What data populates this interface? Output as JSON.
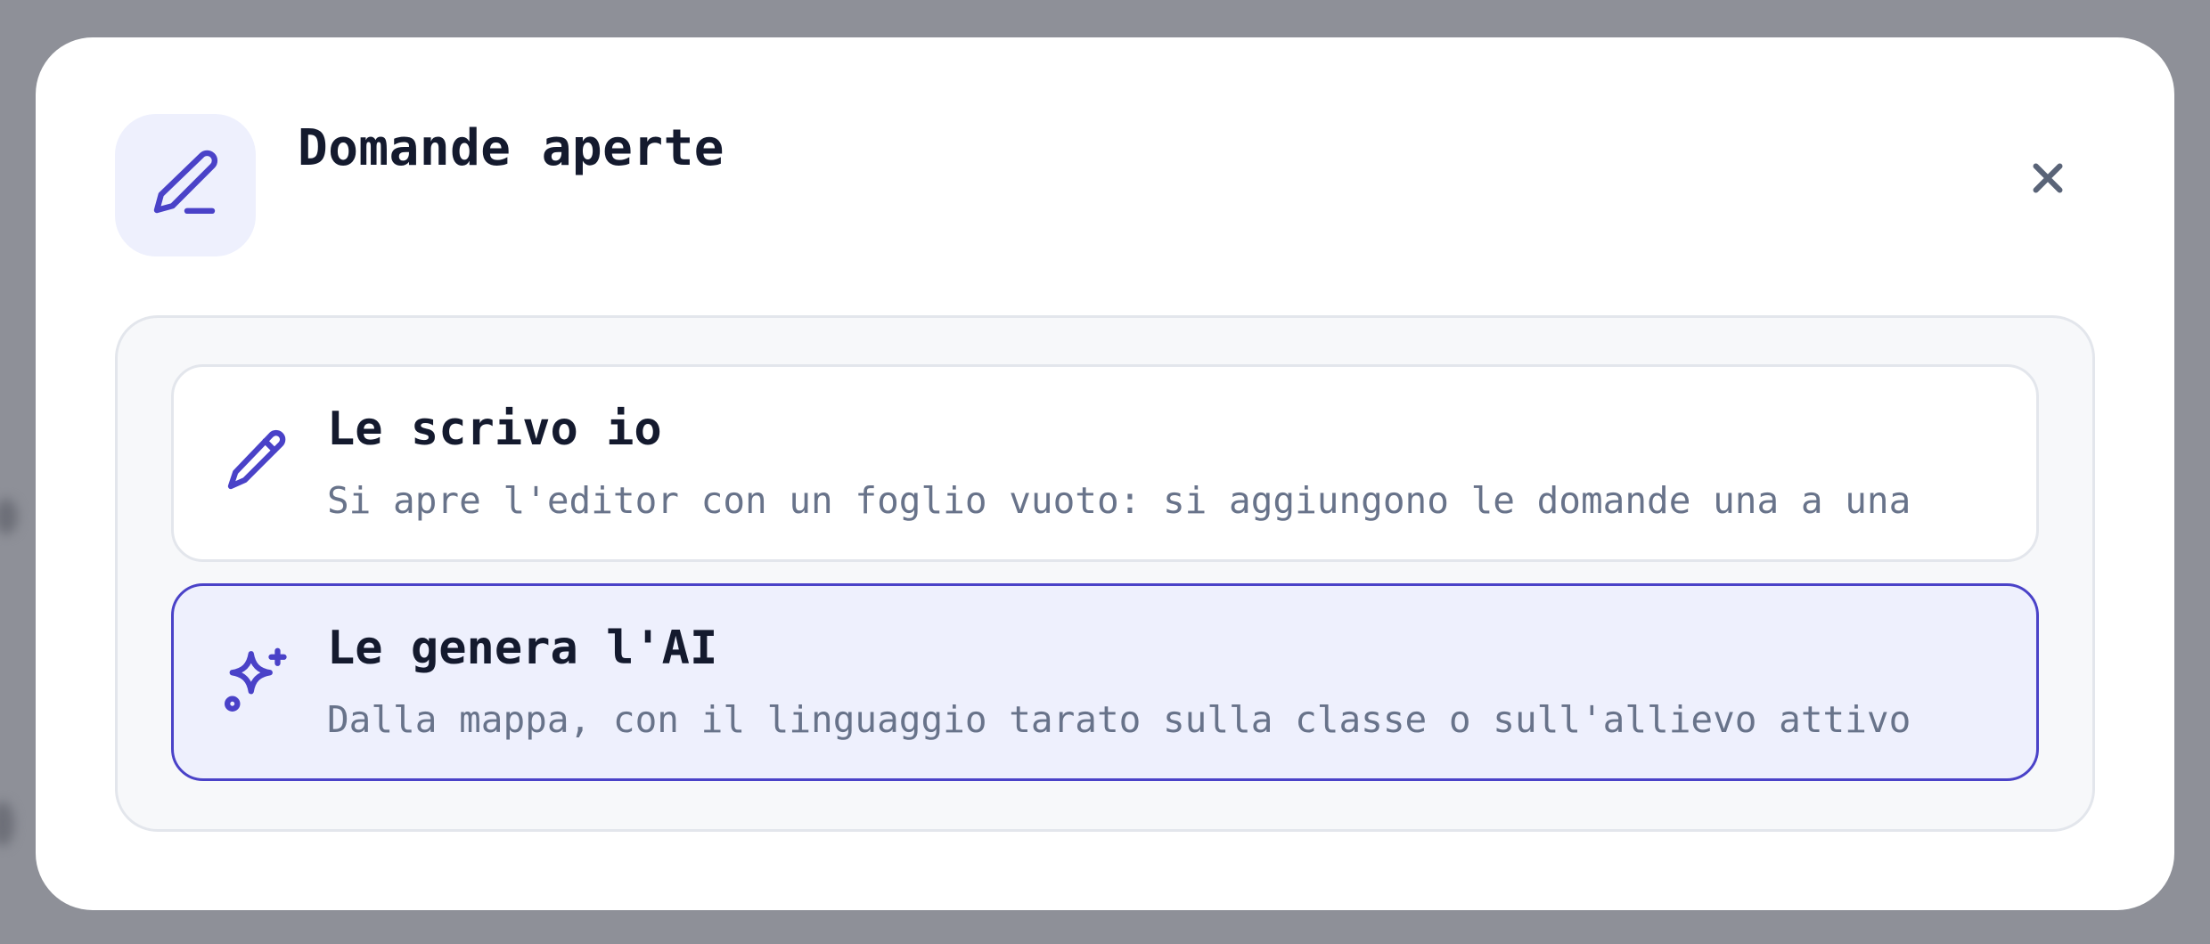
{
  "dialog": {
    "title": "Domande aperte",
    "header_icon": "pencil-line-icon",
    "close_icon": "close-icon"
  },
  "options": [
    {
      "title": "Le scrivo io",
      "description": "Si apre l'editor con un foglio vuoto: si aggiungono le domande una a una",
      "icon": "pencil-icon",
      "selected": false
    },
    {
      "title": "Le genera l'AI",
      "description": "Dalla mappa, con il linguaggio tarato sulla classe o sull'allievo attivo",
      "icon": "sparkles-icon",
      "selected": true
    }
  ],
  "colors": {
    "accent": "#4a42c8",
    "accent_soft": "#eef0fd",
    "title_text": "#141a2e",
    "muted_text": "#68738a",
    "backdrop": "#8e9098"
  }
}
